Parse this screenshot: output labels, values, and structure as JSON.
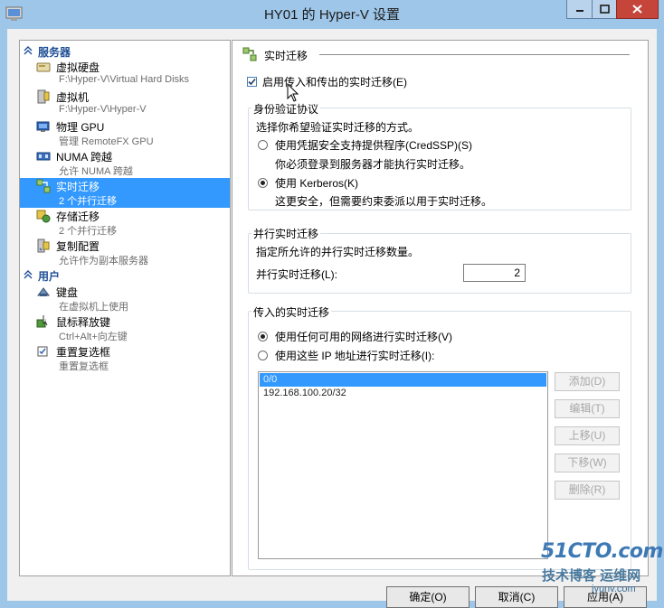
{
  "window": {
    "title": "HY01 的 Hyper-V 设置"
  },
  "nav": {
    "sections": [
      {
        "label": "服务器"
      },
      {
        "label": "用户"
      }
    ],
    "items": [
      {
        "title": "虚拟硬盘",
        "subtitle": "F:\\Hyper-V\\Virtual Hard Disks",
        "icon": "hard-disk-icon"
      },
      {
        "title": "虚拟机",
        "subtitle": "F:\\Hyper-V\\Hyper-V",
        "icon": "virtual-machine-icon"
      },
      {
        "title": "物理 GPU",
        "subtitle": "管理 RemoteFX GPU",
        "icon": "gpu-icon"
      },
      {
        "title": "NUMA 跨越",
        "subtitle": "允许 NUMA 跨越",
        "icon": "numa-icon"
      },
      {
        "title": "实时迁移",
        "subtitle": "2 个并行迁移",
        "icon": "live-migration-icon",
        "selected": true
      },
      {
        "title": "存储迁移",
        "subtitle": "2 个并行迁移",
        "icon": "storage-migration-icon"
      },
      {
        "title": "复制配置",
        "subtitle": "允许作为副本服务器",
        "icon": "replication-icon"
      },
      {
        "title": "键盘",
        "subtitle": "在虚拟机上使用",
        "icon": "keyboard-icon"
      },
      {
        "title": "鼠标释放键",
        "subtitle": "Ctrl+Alt+向左键",
        "icon": "mouse-release-icon"
      },
      {
        "title": "重置复选框",
        "subtitle": "重置复选框",
        "icon": "reset-checkbox-icon"
      }
    ]
  },
  "pane": {
    "heading": "实时迁移",
    "enable_checkbox": {
      "label": "启用传入和传出的实时迁移(E)",
      "checked": true
    },
    "auth": {
      "title": "身份验证协议",
      "description": "选择你希望验证实时迁移的方式。",
      "options": [
        {
          "label": "使用凭据安全支持提供程序(CredSSP)(S)",
          "note": "你必须登录到服务器才能执行实时迁移。",
          "selected": false
        },
        {
          "label": "使用 Kerberos(K)",
          "note": "这更安全，但需要约束委派以用于实时迁移。",
          "selected": true
        }
      ]
    },
    "concurrent": {
      "title": "并行实时迁移",
      "description": "指定所允许的并行实时迁移数量。",
      "field_label": "并行实时迁移(L):",
      "value": "2"
    },
    "incoming": {
      "title": "传入的实时迁移",
      "options": [
        {
          "label": "使用任何可用的网络进行实时迁移(V)",
          "selected": true
        },
        {
          "label": "使用这些 IP 地址进行实时迁移(I):",
          "selected": false
        }
      ],
      "list_items": [
        {
          "text": "0/0",
          "selected": true
        },
        {
          "text": "192.168.100.20/32",
          "selected": false
        }
      ],
      "buttons": [
        "添加(D)",
        "编辑(T)",
        "上移(U)",
        "下移(W)",
        "删除(R)"
      ]
    }
  },
  "footer": {
    "ok": "确定(O)",
    "cancel": "取消(C)",
    "apply": "应用(A)"
  },
  "watermark": {
    "brand": "51CTO.com",
    "line2": "技术博客 运维网",
    "url": "iyunv.com"
  }
}
